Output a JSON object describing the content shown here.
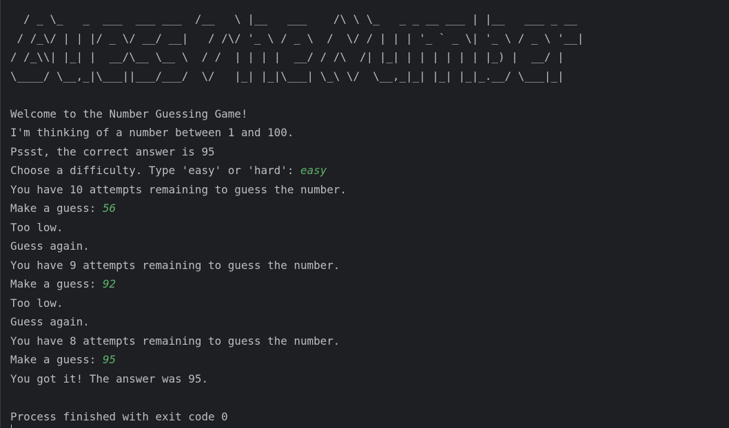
{
  "banner": [
    "  / _ \\_   _  ___  ___ ___  /__   \\ |__   ___    /\\ \\ \\_   _ _ __ ___ | |__   ___ _ __",
    " / /_\\/ | | |/ _ \\/ __/ __|   / /\\/ '_ \\ / _ \\  /  \\/ / | | | '_ ` _ \\| '_ \\ / _ \\ '__|",
    "/ /_\\\\| |_| |  __/\\__ \\__ \\  / /  | | | |  __/ / /\\  /| |_| | | | | | | |_) |  __/ |",
    "\\____/ \\__,_|\\___||___/___/  \\/   |_| |_|\\___| \\_\\ \\/  \\__,_|_| |_| |_|_.__/ \\___|_|"
  ],
  "session": [
    {
      "text": "Welcome to the Number Guessing Game!"
    },
    {
      "text": "I'm thinking of a number between 1 and 100."
    },
    {
      "text": "Pssst, the correct answer is 95"
    },
    {
      "text": "Choose a difficulty. Type 'easy' or 'hard': ",
      "input": "easy"
    },
    {
      "text": "You have 10 attempts remaining to guess the number."
    },
    {
      "text": "Make a guess: ",
      "input": "56"
    },
    {
      "text": "Too low."
    },
    {
      "text": "Guess again."
    },
    {
      "text": "You have 9 attempts remaining to guess the number."
    },
    {
      "text": "Make a guess: ",
      "input": "92"
    },
    {
      "text": "Too low."
    },
    {
      "text": "Guess again."
    },
    {
      "text": "You have 8 attempts remaining to guess the number."
    },
    {
      "text": "Make a guess: ",
      "input": "95"
    },
    {
      "text": "You got it! The answer was 95."
    }
  ],
  "exit_message": "Process finished with exit code 0",
  "colors": {
    "background": "#1e1f22",
    "text": "#bcbec4",
    "user_input": "#5fb36c"
  }
}
